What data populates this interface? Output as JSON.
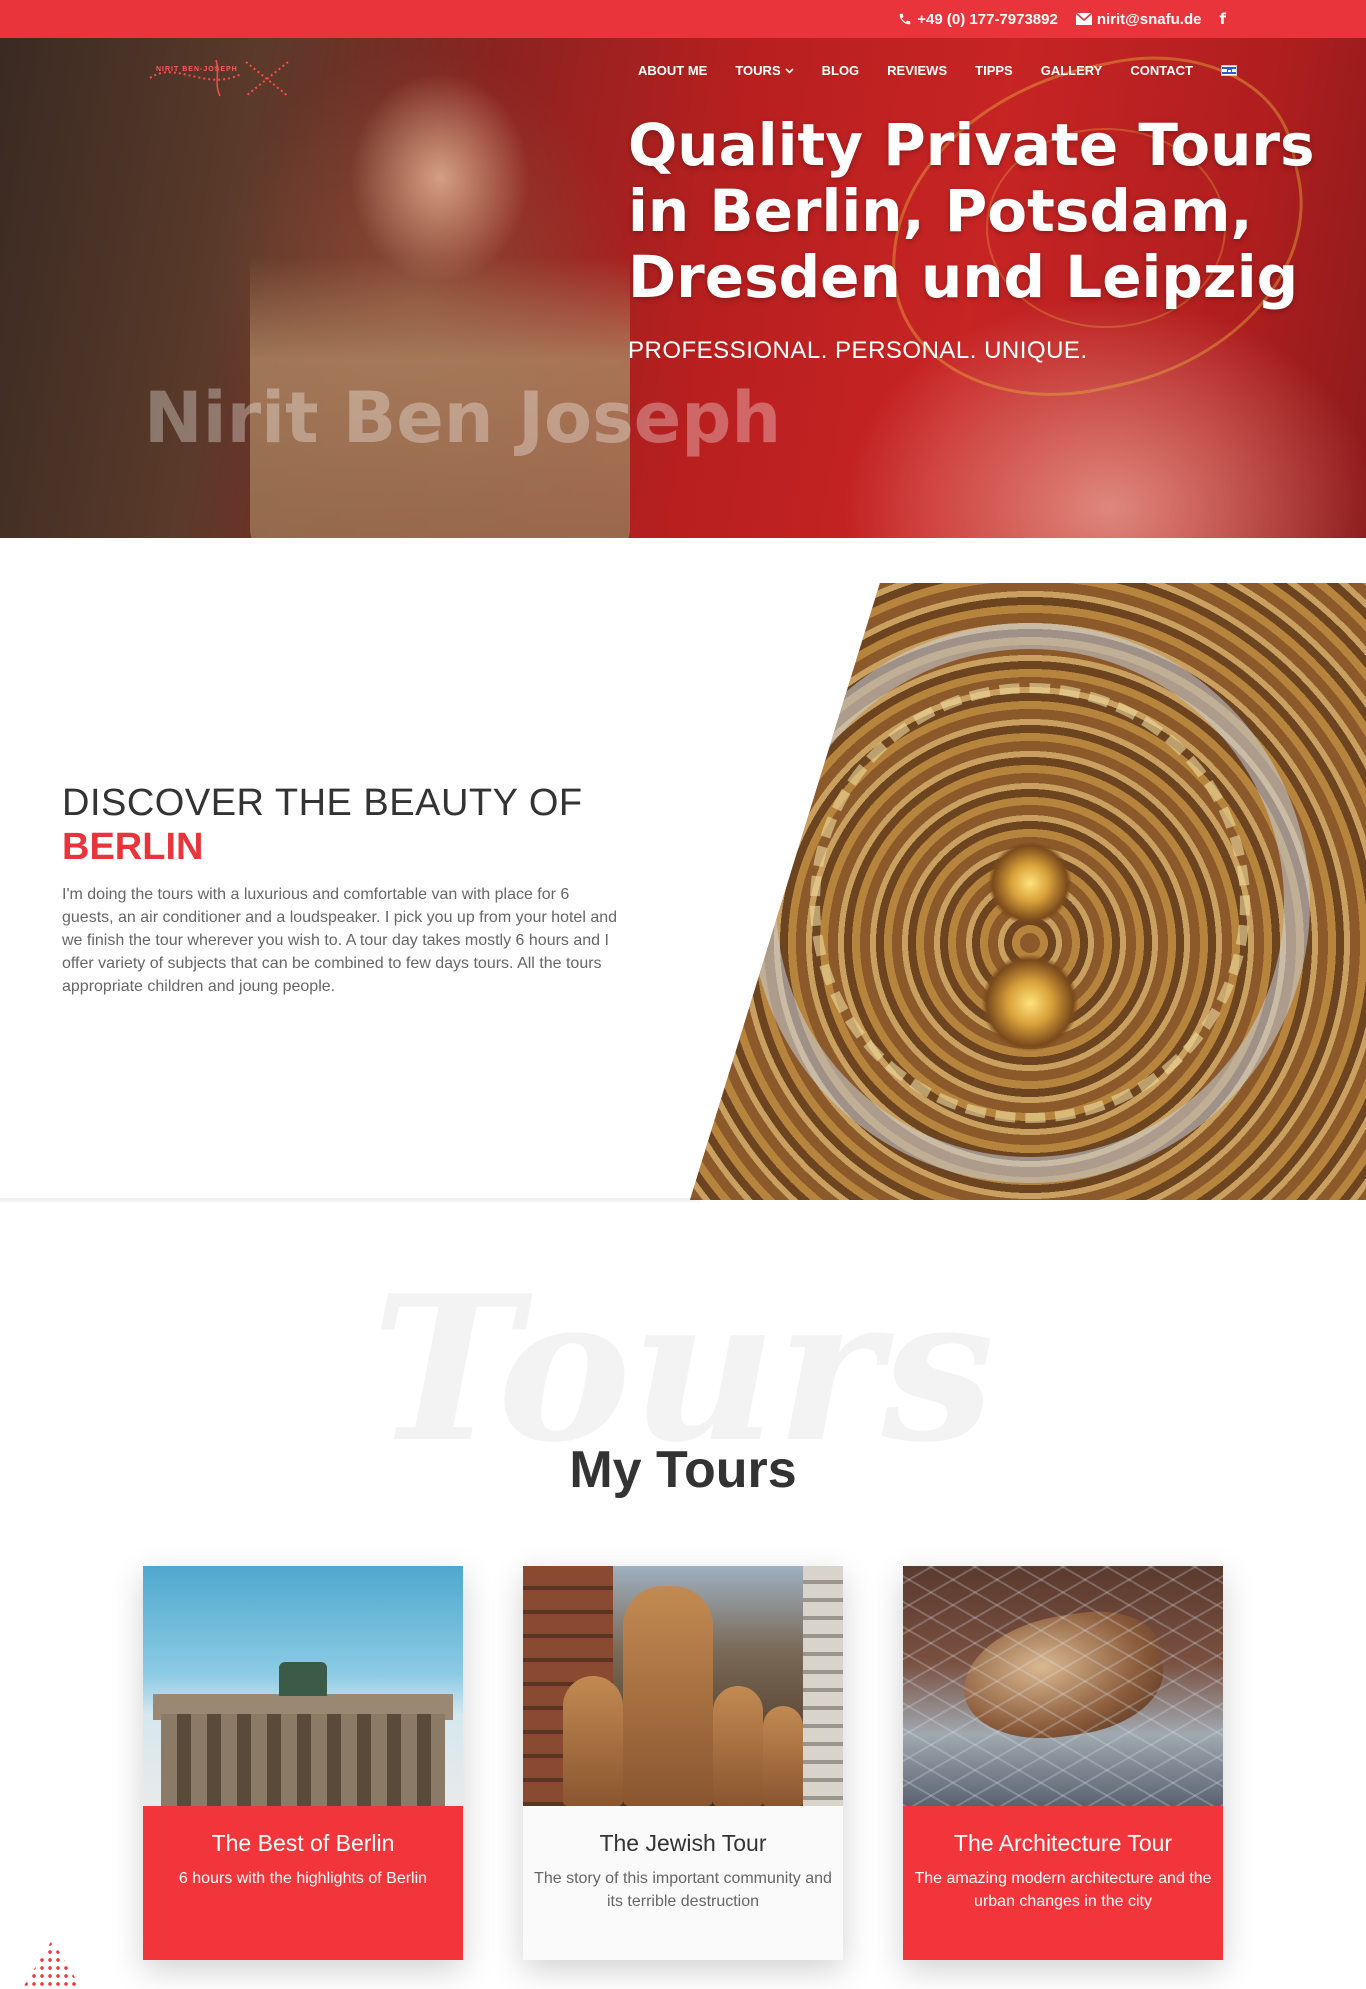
{
  "topbar": {
    "phone": "+49 (0) 177-7973892",
    "email": "nirit@snafu.de",
    "facebook": "f",
    "accent_color": "#e8343a"
  },
  "logo": {
    "name": "NIRIT BEN-JOSEPH"
  },
  "nav": {
    "items": [
      "ABOUT ME",
      "TOURS",
      "BLOG",
      "REVIEWS",
      "TIPPS",
      "GALLERY",
      "CONTACT"
    ],
    "language_icon": "israel-flag-icon"
  },
  "hero": {
    "title_lines": [
      "Quality Private Tours",
      "in Berlin, Potsdam,",
      "Dresden und Leipzig"
    ],
    "subtitle": "PROFESSIONAL. PERSONAL. UNIQUE.",
    "watermark": "Nirit Ben Joseph"
  },
  "discover": {
    "heading": "DISCOVER THE BEAUTY OF",
    "accent": "BERLIN",
    "text": "I'm doing the tours with a luxurious and comfortable van with place for 6 guests, an air conditioner and a loudspeaker. I pick you up from your hotel and we finish the tour wherever you wish to. A tour day takes mostly 6 hours and I offer variety of subjects that can be combined to few days tours. All the tours appropriate children and joung people."
  },
  "tours": {
    "watermark": "Tours",
    "title": "My Tours",
    "cards": [
      {
        "title": "The Best of Berlin",
        "desc": "6 hours with the highlights of Berlin"
      },
      {
        "title": "The Jewish Tour",
        "desc": "The story of this important community and its terrible destruction"
      },
      {
        "title": "The Architecture Tour",
        "desc": "The amazing modern architecture and the urban changes in the city"
      }
    ]
  }
}
